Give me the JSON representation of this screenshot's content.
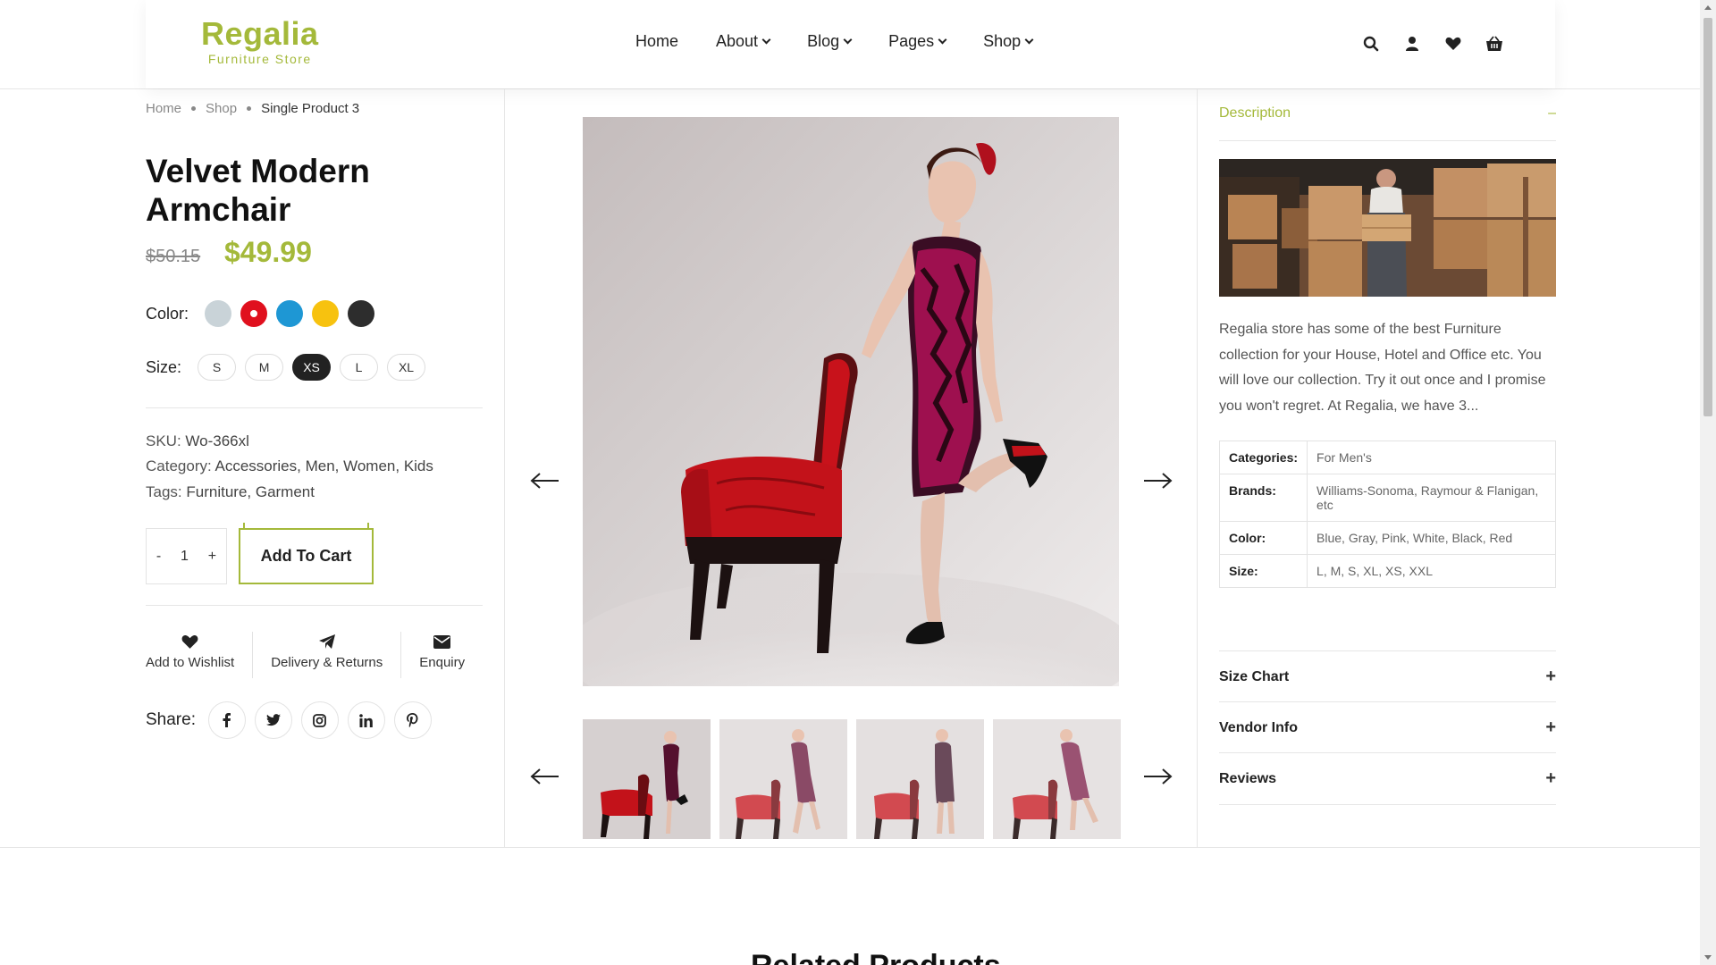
{
  "header": {
    "logo_name": "Regalia",
    "logo_tagline": "Furniture Store",
    "nav": [
      {
        "label": "Home",
        "has_dropdown": false
      },
      {
        "label": "About",
        "has_dropdown": true
      },
      {
        "label": "Blog",
        "has_dropdown": true
      },
      {
        "label": "Pages",
        "has_dropdown": true
      },
      {
        "label": "Shop",
        "has_dropdown": true
      }
    ],
    "icons": [
      "search-icon",
      "user-icon",
      "heart-icon",
      "basket-icon"
    ]
  },
  "breadcrumb": [
    "Home",
    "Shop",
    "Single Product 3"
  ],
  "product": {
    "title": "Velvet Modern Armchair",
    "old_price": "$50.15",
    "price": "$49.99",
    "color_label": "Color:",
    "colors": [
      "#c9d3d8",
      "#e0101e",
      "#1e97d4",
      "#f7c20f",
      "#2d2d2d"
    ],
    "selected_color_index": 1,
    "size_label": "Size:",
    "sizes": [
      "S",
      "M",
      "XS",
      "L",
      "XL"
    ],
    "selected_size": "XS",
    "sku_label": "SKU:",
    "sku": "Wo-366xl",
    "category_label": "Category:",
    "category": "Accessories, Men, Women, Kids",
    "tags_label": "Tags:",
    "tags": "Furniture, Garment",
    "qty_minus": "-",
    "qty_value": "1",
    "qty_plus": "+",
    "add_to_cart": "Add To Cart"
  },
  "actions": {
    "wishlist": "Add to Wishlist",
    "delivery": "Delivery & Returns",
    "enquiry": "Enquiry"
  },
  "share": {
    "label": "Share:",
    "networks": [
      "facebook-icon",
      "twitter-icon",
      "instagram-icon",
      "linkedin-icon",
      "pinterest-icon"
    ]
  },
  "gallery": {
    "thumbnail_count": 4
  },
  "sidebar": {
    "description_title": "Description",
    "description_toggle": "–",
    "description_text": "Regalia store has some of the best Furniture collection for your House, Hotel and Office etc. You will love our collection. Try it out once and I promise you won't regret. At Regalia, we have 3...",
    "specs": [
      {
        "key": "Categories:",
        "value": "For Men's"
      },
      {
        "key": "Brands:",
        "value": "Williams-Sonoma, Raymour & Flanigan, etc"
      },
      {
        "key": "Color:",
        "value": "Blue, Gray, Pink, White, Black, Red"
      },
      {
        "key": "Size:",
        "value": "L, M, S, XL, XS, XXL"
      }
    ],
    "accordions": [
      {
        "label": "Size Chart",
        "toggle": "+"
      },
      {
        "label": "Vendor Info",
        "toggle": "+"
      },
      {
        "label": "Reviews",
        "toggle": "+"
      }
    ]
  },
  "related_title": "Related Products",
  "colors": {
    "accent": "#a4b93a",
    "dark": "#222222"
  }
}
